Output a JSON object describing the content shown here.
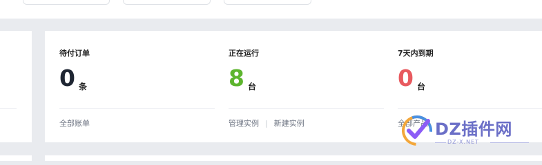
{
  "stats": [
    {
      "title": "待付订单",
      "value": "0",
      "unit": "条",
      "value_color": "#1f2633",
      "links": [
        "全部账单"
      ]
    },
    {
      "title": "正在运行",
      "value": "8",
      "unit": "台",
      "value_color": "#5db52e",
      "links": [
        "管理实例",
        "新建实例"
      ],
      "separator": "|"
    },
    {
      "title": "7天内到期",
      "value": "0",
      "unit": "台",
      "value_color": "#e85a5f",
      "links": [
        "全部产品"
      ]
    }
  ],
  "watermark": {
    "text": "DZ插件网",
    "subtext": "DZ-X.NET"
  }
}
